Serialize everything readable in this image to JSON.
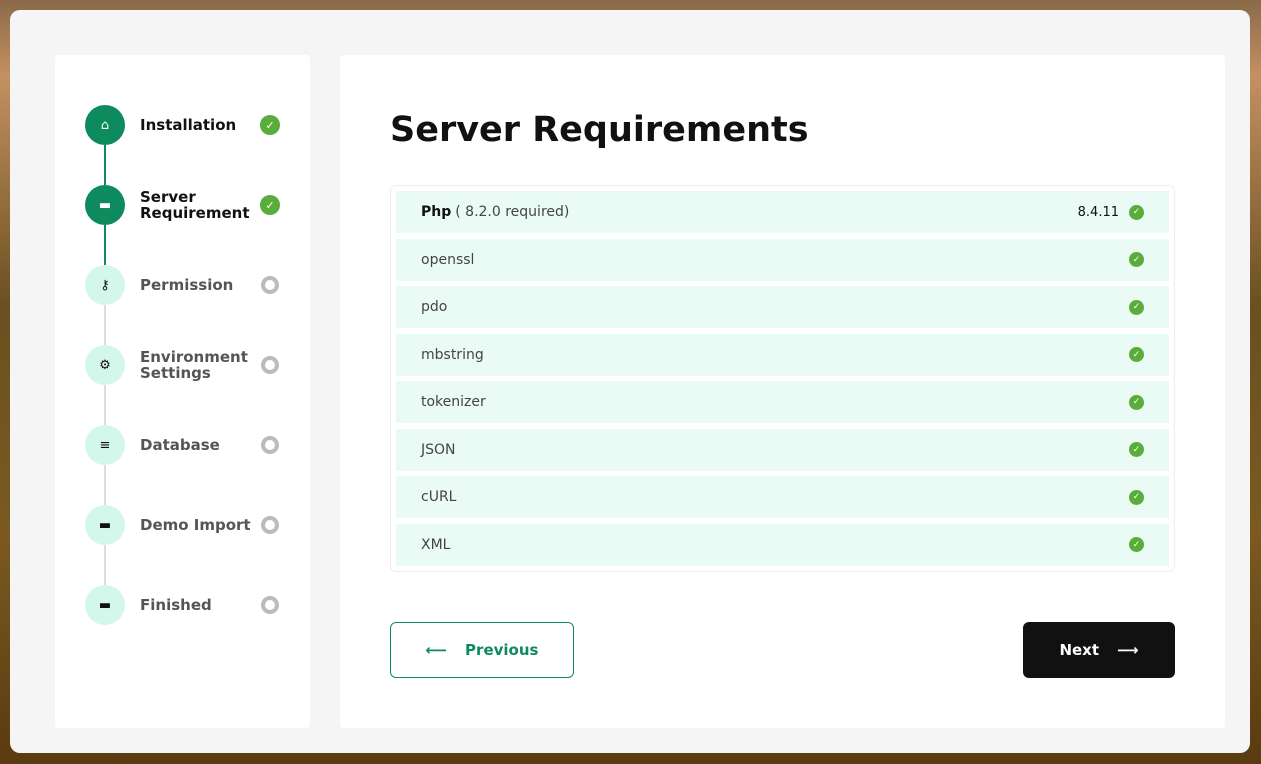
{
  "steps": [
    {
      "label": "Installation",
      "icon": "home-icon",
      "done": true
    },
    {
      "label": "Server Requirement",
      "icon": "server-icon",
      "done": true
    },
    {
      "label": "Permission",
      "icon": "key-icon",
      "done": false
    },
    {
      "label": "Environment Settings",
      "icon": "gear-icon",
      "done": false
    },
    {
      "label": "Database",
      "icon": "database-icon",
      "done": false
    },
    {
      "label": "Demo Import",
      "icon": "server-icon",
      "done": false
    },
    {
      "label": "Finished",
      "icon": "server-icon",
      "done": false
    }
  ],
  "main": {
    "title": "Server Requirements",
    "php": {
      "name": "Php",
      "required": "( 8.2.0 required)",
      "version": "8.4.11"
    },
    "extensions": [
      "openssl",
      "pdo",
      "mbstring",
      "tokenizer",
      "JSON",
      "cURL",
      "XML"
    ],
    "previous_label": "Previous",
    "next_label": "Next"
  },
  "colors": {
    "accent": "#0e8a5f",
    "ok": "#5aad3a"
  }
}
